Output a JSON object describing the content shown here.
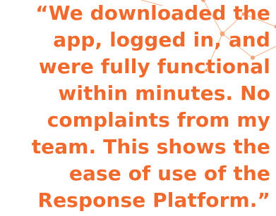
{
  "colors": {
    "text": "#f16a2d",
    "decor": "#f4a477",
    "background": "#ffffff"
  },
  "decor": {
    "description": "faint orange network-node line graphic behind the quote"
  },
  "quote": {
    "lines": [
      "“We downloaded the",
      "app, logged in, and",
      "were fully functional",
      "within minutes. No",
      "complaints from my",
      "team. This shows the",
      "ease of use of the",
      "Response Platform.”"
    ]
  }
}
